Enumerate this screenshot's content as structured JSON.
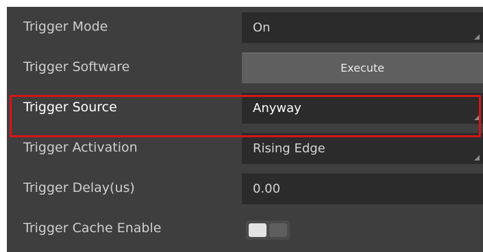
{
  "properties": [
    {
      "label": "Trigger Mode",
      "value": "On"
    },
    {
      "label": "Trigger Software",
      "button_label": "Execute"
    },
    {
      "label": "Trigger Source",
      "value": "Anyway"
    },
    {
      "label": "Trigger Activation",
      "value": "Rising Edge"
    },
    {
      "label": "Trigger Delay(us)",
      "value": "0.00"
    },
    {
      "label": "Trigger Cache Enable",
      "toggle_on": false
    }
  ],
  "highlight_color": "#d81515"
}
